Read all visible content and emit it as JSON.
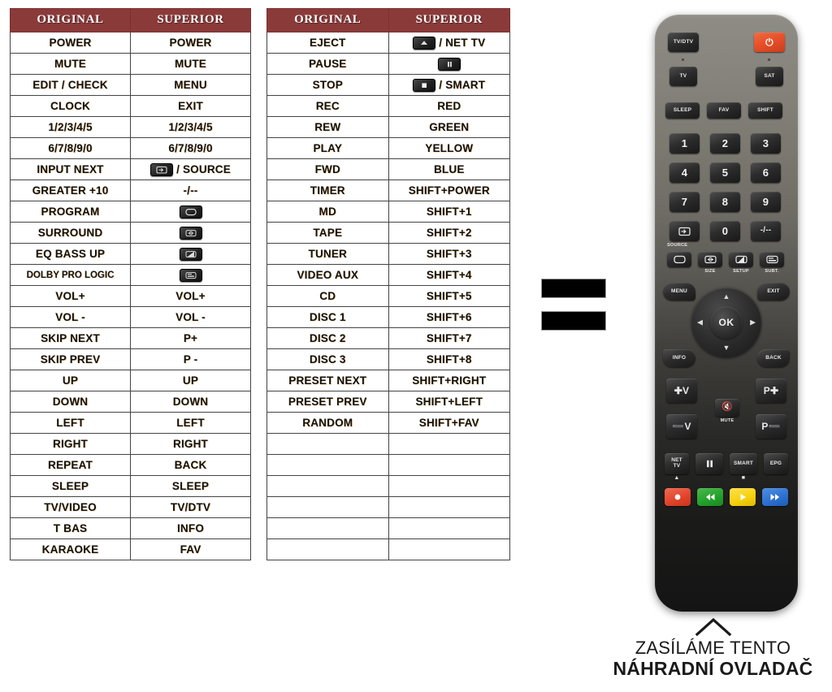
{
  "tables": [
    {
      "id": "table-1",
      "headers": {
        "original": "ORIGINAL",
        "superior": "SUPERIOR"
      },
      "rows": [
        {
          "original": "POWER",
          "superior": "POWER"
        },
        {
          "original": "MUTE",
          "superior": "MUTE"
        },
        {
          "original": "EDIT / CHECK",
          "superior": "MENU"
        },
        {
          "original": "CLOCK",
          "superior": "EXIT"
        },
        {
          "original": "1/2/3/4/5",
          "superior": "1/2/3/4/5"
        },
        {
          "original": "6/7/8/9/0",
          "superior": "6/7/8/9/0"
        },
        {
          "original": "INPUT NEXT",
          "superior": "/ SOURCE",
          "superior_icon": "source-keycap-icon"
        },
        {
          "original": "GREATER +10",
          "superior": "-/--"
        },
        {
          "original": "PROGRAM",
          "superior": "",
          "superior_icon": "size-keycap-icon"
        },
        {
          "original": "SURROUND",
          "superior": "",
          "superior_icon": "setup-keycap-icon"
        },
        {
          "original": "EQ BASS UP",
          "superior": "",
          "superior_icon": "subtitle-keycap-icon"
        },
        {
          "original": "DOLBY PRO LOGIC",
          "superior": "",
          "superior_icon": "teletext-keycap-icon",
          "small": true
        },
        {
          "original": "VOL+",
          "superior": "VOL+"
        },
        {
          "original": "VOL -",
          "superior": "VOL -"
        },
        {
          "original": "SKIP NEXT",
          "superior": "P+"
        },
        {
          "original": "SKIP PREV",
          "superior": "P -"
        },
        {
          "original": "UP",
          "superior": "UP"
        },
        {
          "original": "DOWN",
          "superior": "DOWN"
        },
        {
          "original": "LEFT",
          "superior": "LEFT"
        },
        {
          "original": "RIGHT",
          "superior": "RIGHT"
        },
        {
          "original": "REPEAT",
          "superior": "BACK"
        },
        {
          "original": "SLEEP",
          "superior": "SLEEP"
        },
        {
          "original": "TV/VIDEO",
          "superior": "TV/DTV"
        },
        {
          "original": "T BAS",
          "superior": "INFO"
        },
        {
          "original": "KARAOKE",
          "superior": "FAV"
        }
      ]
    },
    {
      "id": "table-2",
      "headers": {
        "original": "ORIGINAL",
        "superior": "SUPERIOR"
      },
      "rows": [
        {
          "original": "EJECT",
          "superior": "/ NET TV",
          "superior_icon": "eject-keycap-icon"
        },
        {
          "original": "PAUSE",
          "superior": "",
          "superior_icon": "pause-keycap-icon"
        },
        {
          "original": "STOP",
          "superior": "/ SMART",
          "superior_icon": "stop-keycap-icon"
        },
        {
          "original": "REC",
          "superior": "RED"
        },
        {
          "original": "REW",
          "superior": "GREEN"
        },
        {
          "original": "PLAY",
          "superior": "YELLOW"
        },
        {
          "original": "FWD",
          "superior": "BLUE"
        },
        {
          "original": "TIMER",
          "superior": "SHIFT+POWER"
        },
        {
          "original": "MD",
          "superior": "SHIFT+1"
        },
        {
          "original": "TAPE",
          "superior": "SHIFT+2"
        },
        {
          "original": "TUNER",
          "superior": "SHIFT+3"
        },
        {
          "original": "VIDEO AUX",
          "superior": "SHIFT+4"
        },
        {
          "original": "CD",
          "superior": "SHIFT+5"
        },
        {
          "original": "DISC 1",
          "superior": "SHIFT+6"
        },
        {
          "original": "DISC 2",
          "superior": "SHIFT+7"
        },
        {
          "original": "DISC 3",
          "superior": "SHIFT+8"
        },
        {
          "original": "PRESET NEXT",
          "superior": "SHIFT+RIGHT"
        },
        {
          "original": "PRESET PREV",
          "superior": "SHIFT+LEFT"
        },
        {
          "original": "RANDOM",
          "superior": "SHIFT+FAV"
        },
        {
          "original": "",
          "superior": ""
        },
        {
          "original": "",
          "superior": ""
        },
        {
          "original": "",
          "superior": ""
        },
        {
          "original": "",
          "superior": ""
        },
        {
          "original": "",
          "superior": ""
        },
        {
          "original": "",
          "superior": ""
        }
      ]
    }
  ],
  "redactions": {
    "count": 2,
    "color": "#000000"
  },
  "remote": {
    "colors": {
      "power_button": "#e8502a",
      "red": "#e0422a",
      "green": "#22a02a",
      "yellow": "#f5d00d",
      "blue": "#2b6fd1",
      "body_top": "#8e8c84",
      "body_bottom": "#141414"
    },
    "buttons": {
      "tv_dtv": "TV/DTV",
      "power": "power-icon",
      "tv": "TV",
      "sat": "SAT",
      "sleep": "SLEEP",
      "fav": "FAV",
      "shift": "SHIFT",
      "num_1": "1",
      "num_2": "2",
      "num_3": "3",
      "num_4": "4",
      "num_5": "5",
      "num_6": "6",
      "num_7": "7",
      "num_8": "8",
      "num_9": "9",
      "source": "SOURCE",
      "num_0": "0",
      "dash": "-/--",
      "size": "SIZE",
      "setup": "SETUP",
      "subtitle": "SUBT.",
      "menu": "MENU",
      "exit": "EXIT",
      "ok": "OK",
      "info": "INFO",
      "back": "BACK",
      "vol_up": "V",
      "vol_down": "V",
      "prog_up": "P",
      "prog_down": "P",
      "mute": "MUTE",
      "net_tv": "NET\nTV",
      "net_tv_l1": "NET",
      "net_tv_l2": "TV",
      "pause": "pause-icon",
      "smart": "SMART",
      "epg": "EPG",
      "record": "record-icon",
      "rewind": "rewind-icon",
      "play": "play-icon",
      "forward": "forward-icon"
    }
  },
  "caption": {
    "chevron": "chevron-up-icon",
    "line1": "ZASÍLÁME TENTO",
    "line2": "NÁHRADNÍ OVLADAČ"
  }
}
